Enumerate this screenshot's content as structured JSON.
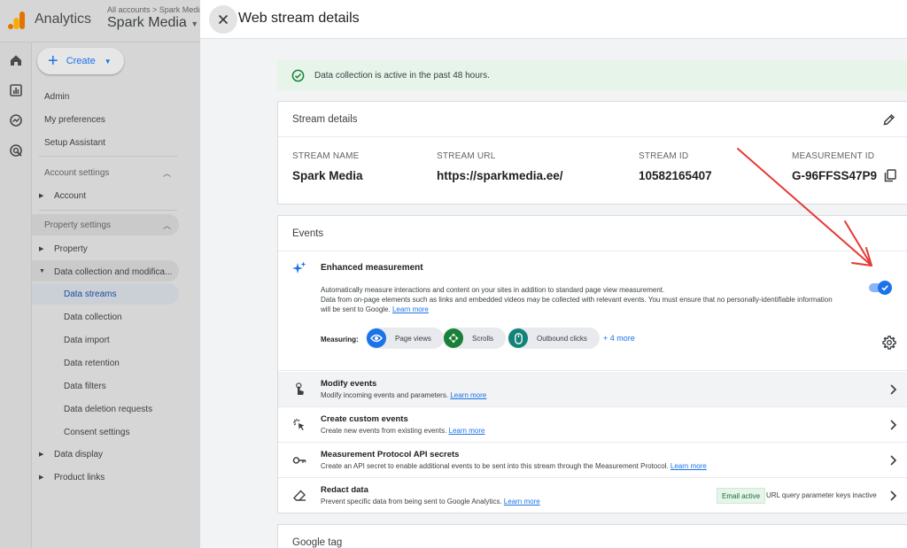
{
  "app": {
    "name": "Analytics",
    "breadcrumb": "All accounts > Spark Media",
    "account_name": "Spark Media"
  },
  "sidebar": {
    "create_label": "Create",
    "items": [
      {
        "label": "Admin"
      },
      {
        "label": "My preferences"
      },
      {
        "label": "Setup Assistant"
      }
    ],
    "account_settings": {
      "header": "Account settings",
      "items": [
        {
          "label": "Account"
        }
      ]
    },
    "property_settings": {
      "header": "Property settings",
      "items": [
        {
          "label": "Property"
        },
        {
          "label": "Data collection and modifica..."
        }
      ],
      "data_collection_children": [
        {
          "label": "Data streams"
        },
        {
          "label": "Data collection"
        },
        {
          "label": "Data import"
        },
        {
          "label": "Data retention"
        },
        {
          "label": "Data filters"
        },
        {
          "label": "Data deletion requests"
        },
        {
          "label": "Consent settings"
        }
      ],
      "more_items": [
        {
          "label": "Data display"
        },
        {
          "label": "Product links"
        }
      ]
    }
  },
  "panel": {
    "title": "Web stream details",
    "status_message": "Data collection is active in the past 48 hours.",
    "stream_details": {
      "header": "Stream details",
      "fields": [
        {
          "label": "STREAM NAME",
          "value": "Spark Media"
        },
        {
          "label": "STREAM URL",
          "value": "https://sparkmedia.ee/"
        },
        {
          "label": "STREAM ID",
          "value": "10582165407"
        },
        {
          "label": "MEASUREMENT ID",
          "value": "G-96FFSS47P9"
        }
      ]
    },
    "events": {
      "header": "Events",
      "enhanced_measurement": {
        "title": "Enhanced measurement",
        "description_1": "Automatically measure interactions and content on your sites in addition to standard page view measurement.",
        "description_2": "Data from on-page elements such as links and embedded videos may be collected with relevant events. You must ensure that no personally-identifiable information will be sent to Google.",
        "learn_more": "Learn more",
        "enabled": true,
        "measuring_label": "Measuring:",
        "chips": [
          {
            "label": "Page views",
            "icon": "eye-icon",
            "color": "#1a73e8"
          },
          {
            "label": "Scrolls",
            "icon": "scroll-arrows-icon",
            "color": "#188038"
          },
          {
            "label": "Outbound clicks",
            "icon": "mouse-icon",
            "color": "#12837a"
          }
        ],
        "more_link": "+ 4 more"
      },
      "rows": [
        {
          "title": "Modify events",
          "desc": "Modify incoming events and parameters.",
          "link": "Learn more",
          "icon": "touch-icon"
        },
        {
          "title": "Create custom events",
          "desc": "Create new events from existing events.",
          "link": "Learn more",
          "icon": "sparkle-click-icon"
        },
        {
          "title": "Measurement Protocol API secrets",
          "desc": "Create an API secret to enable additional events to be sent into this stream through the Measurement Protocol.",
          "link": "Learn more",
          "icon": "key-icon"
        },
        {
          "title": "Redact data",
          "desc": "Prevent specific data from being sent to Google Analytics.",
          "link": "Learn more",
          "icon": "eraser-icon",
          "badge_active": "Email active",
          "badge_inactive": "URL query parameter keys inactive"
        }
      ]
    },
    "google_tag": {
      "header": "Google tag"
    }
  },
  "colors": {
    "accent": "#1a73e8",
    "success": "#188038",
    "annotation_arrow": "#e53935"
  }
}
